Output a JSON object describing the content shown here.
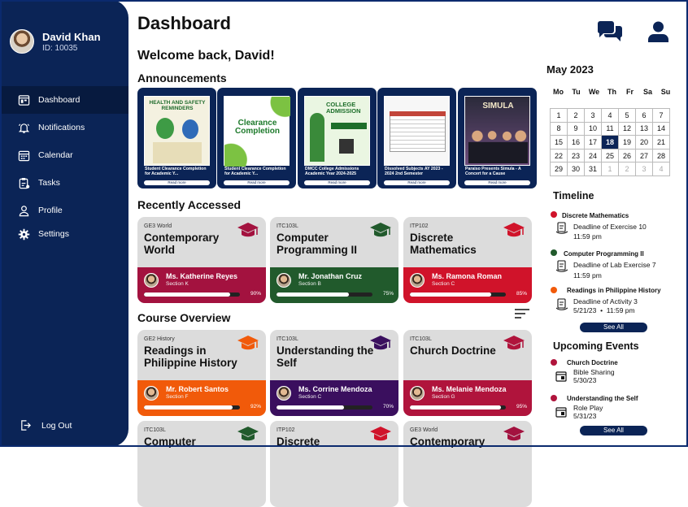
{
  "user": {
    "name": "David Khan",
    "id_label": "ID: 10035"
  },
  "nav": {
    "items": [
      {
        "label": "Dashboard",
        "icon": "dashboard-icon"
      },
      {
        "label": "Notifications",
        "icon": "bell-icon"
      },
      {
        "label": "Calendar",
        "icon": "calendar-icon"
      },
      {
        "label": "Tasks",
        "icon": "tasks-icon"
      },
      {
        "label": "Profile",
        "icon": "user-icon"
      },
      {
        "label": "Settings",
        "icon": "gear-icon"
      }
    ],
    "logout": "Log Out"
  },
  "page": {
    "title": "Dashboard",
    "welcome": "Welcome back, David!"
  },
  "sections": {
    "announcements": "Announcements",
    "recently_accessed": "Recently Accessed",
    "course_overview": "Course Overview"
  },
  "announcements": [
    {
      "caption": "Student Clearance Completion for Academic Y...",
      "button": "Read more",
      "poster": "HEALTH AND SAFETY REMINDERS"
    },
    {
      "caption": "Student Clearance Completion for Academic Y...",
      "button": "Read more",
      "poster": "Clearance Completion"
    },
    {
      "caption": "DMCC College Admissions Academic Year 2024-2025",
      "button": "Read more",
      "poster": "COLLEGE ADMISSION"
    },
    {
      "caption": "Dissolved Subjects AY 2023 - 2024 2nd Semester",
      "button": "Read more",
      "poster": ""
    },
    {
      "caption": "Paraiso Presents Simula - A Concert for a Cause",
      "button": "Read more",
      "poster": "SIMULA"
    }
  ],
  "recent": [
    {
      "code": "GE3 World",
      "name": "Contemporary World",
      "teacher": "Ms. Katherine Reyes",
      "section": "Section K",
      "progress": "90%",
      "color": "#a3123f"
    },
    {
      "code": "ITC103L",
      "name": "Computer Programming II",
      "teacher": "Mr. Jonathan Cruz",
      "section": "Section B",
      "progress": "75%",
      "color": "#215a2c"
    },
    {
      "code": "ITP102",
      "name": "Discrete Mathematics",
      "teacher": "Ms. Ramona Roman",
      "section": "Section C",
      "progress": "85%",
      "color": "#d0132a"
    }
  ],
  "overview": [
    {
      "code": "GE2 History",
      "name": "Readings in Philippine History",
      "teacher": "Mr. Robert Santos",
      "section": "Section F",
      "progress": "92%",
      "color": "#f15a0a"
    },
    {
      "code": "ITC103L",
      "name": "Understanding the Self",
      "teacher": "Ms. Corrine Mendoza",
      "section": "Section C",
      "progress": "70%",
      "color": "#3a0f5e"
    },
    {
      "code": "ITC103L",
      "name": "Church Doctrine",
      "teacher": "Ms. Melanie Mendoza",
      "section": "Section G",
      "progress": "95%",
      "color": "#b0143c"
    }
  ],
  "overview_row2": [
    {
      "code": "ITC103L",
      "name": "Computer",
      "color": "#215a2c"
    },
    {
      "code": "ITP102",
      "name": "Discrete",
      "color": "#d0132a"
    },
    {
      "code": "GE3 World",
      "name": "Contemporary",
      "color": "#a3123f"
    }
  ],
  "calendar": {
    "month": "May 2023",
    "days_of_week": [
      "Mo",
      "Tu",
      "We",
      "Th",
      "Fr",
      "Sa",
      "Su"
    ],
    "weeks": [
      [
        "1",
        "2",
        "3",
        "4",
        "5",
        "6",
        "7"
      ],
      [
        "8",
        "9",
        "10",
        "11",
        "12",
        "13",
        "14"
      ],
      [
        "15",
        "16",
        "17",
        "18",
        "19",
        "20",
        "21"
      ],
      [
        "22",
        "23",
        "24",
        "25",
        "26",
        "27",
        "28"
      ],
      [
        "29",
        "30",
        "31",
        "1",
        "2",
        "3",
        "4"
      ]
    ],
    "today": "18"
  },
  "timeline": {
    "title": "Timeline",
    "items": [
      {
        "course": "Discrete Mathematics",
        "task": "Deadline of Exercise 10",
        "time": "11:59 pm",
        "color": "#d0132a"
      },
      {
        "course": "Computer Programming II",
        "task": "Deadline of Lab Exercise 7",
        "time": "11:59 pm",
        "color": "#215a2c"
      },
      {
        "course": "Readings in Philippine History",
        "task": "Deadline of Activity 3",
        "time": "5/21/23  •  11:59 pm",
        "color": "#f15a0a"
      }
    ],
    "see_all": "See All"
  },
  "events": {
    "title": "Upcoming Events",
    "items": [
      {
        "course": "Church Doctrine",
        "event": "Bible Sharing",
        "date": "5/30/23",
        "color": "#b0143c"
      },
      {
        "course": "Understanding the Self",
        "event": "Role Play",
        "date": "5/31/23",
        "color": "#b0143c"
      }
    ],
    "see_all": "See All"
  }
}
